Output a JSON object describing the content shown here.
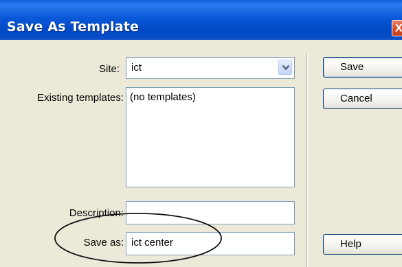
{
  "window": {
    "title": "Save As Template",
    "close_glyph": "X"
  },
  "form": {
    "site_label": "Site:",
    "site_value": "ict",
    "existing_label": "Existing templates:",
    "existing_items": [
      "(no templates)"
    ],
    "description_label": "Description:",
    "description_value": "",
    "saveas_label": "Save as:",
    "saveas_value": "ict center"
  },
  "buttons": {
    "save": "Save",
    "cancel": "Cancel",
    "help": "Help"
  },
  "icons": {
    "dropdown": "chevron-down-icon",
    "close": "close-icon"
  },
  "colors": {
    "titlebar": "#0a58d8",
    "dialog_bg": "#ece9d8",
    "field_border": "#7f9db9",
    "close_button": "#d9532f"
  }
}
